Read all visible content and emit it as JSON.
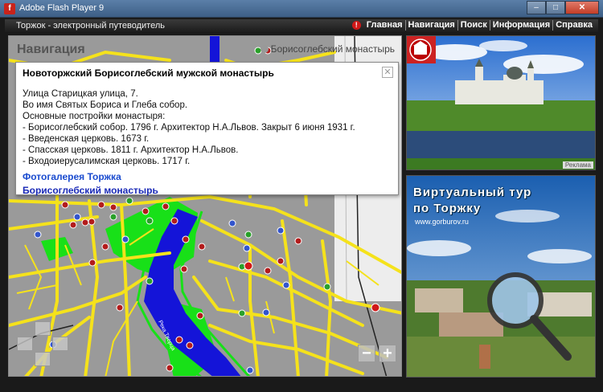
{
  "window": {
    "title": "Adobe Flash Player 9",
    "icon": "f",
    "controls": {
      "minimize": "–",
      "maximize": "□",
      "close": "✕"
    }
  },
  "app": {
    "title": "Торжок - электронный путеводитель"
  },
  "menu": {
    "items": [
      "Главная",
      "Навигация",
      "Поиск",
      "Информация",
      "Справка"
    ]
  },
  "map": {
    "section_title": "Навигация",
    "breadcrumb": "Борисоглебский монастырь",
    "river_label": "Река Тверца"
  },
  "popup": {
    "title": "Новоторжский Борисоглебский мужской монастырь",
    "close": "✕",
    "lines": [
      "Улица Старицкая улица, 7.",
      "Во имя Святых Бориса и Глеба собор.",
      "Основные постройки монастыря:",
      "- Борисоглебский собор. 1796 г. Архитектор Н.А.Львов. Закрыт 6 июня 1931 г.",
      "- Введенская церковь. 1673 г.",
      "- Спасская церковь. 1811 г. Архитектор Н.А.Львов.",
      "- Входоиерусалимская церковь. 1717 г."
    ],
    "link_gallery": "Фотогалерея Торжка",
    "link_monastery": "Борисоглебский монастырь"
  },
  "photo_panel": {
    "ad_label": "Реклама"
  },
  "banner": {
    "line1": "Виртуальный тур",
    "line2": "по Торжку",
    "site": "www.gorburov.ru"
  },
  "zoom": {
    "out": "−",
    "in": "+"
  },
  "colors": {
    "map_bg": "#9a9a9a",
    "road": "#f5e21b",
    "park": "#18e018",
    "river": "#1414d8",
    "menu_active": "#ffffff"
  }
}
